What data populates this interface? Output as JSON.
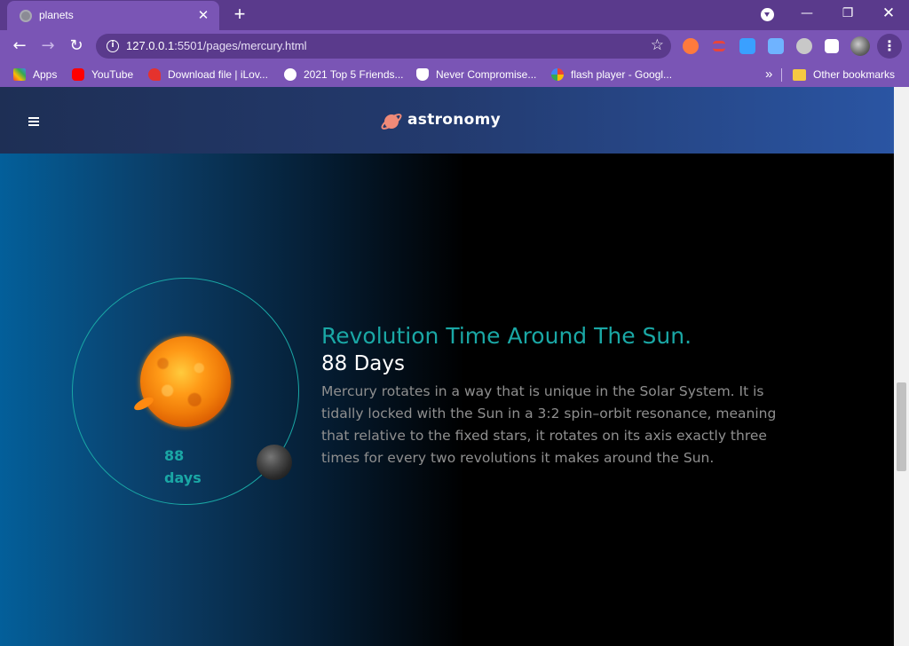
{
  "browser": {
    "tab_title": "planets",
    "tab_close": "✕",
    "new_tab": "+",
    "window_controls": {
      "minimize": "—",
      "restore": "❐",
      "close": "✕"
    },
    "nav": {
      "back": "←",
      "forward": "→",
      "reload": "↻"
    },
    "url_host": "127.0.0.1",
    "url_rest": ":5501/pages/mercury.html",
    "star": "☆",
    "menu": "⋮",
    "extensions": [
      {
        "name": "extension-infinity-icon",
        "color": "#ff7a3d"
      },
      {
        "name": "extension-stack-icon",
        "color": "#e8453c"
      },
      {
        "name": "extension-cloud-icon",
        "color": "#3aa0ff"
      },
      {
        "name": "extension-screen-icon",
        "color": "#6fb3ff"
      },
      {
        "name": "extension-globe-icon",
        "color": "#c8c8c8"
      },
      {
        "name": "extensions-puzzle-icon",
        "color": "#ffffff"
      }
    ]
  },
  "bookmarks": {
    "items": [
      {
        "label": "Apps",
        "icon": "apps-grid-icon",
        "color": "#ea4335"
      },
      {
        "label": "YouTube",
        "icon": "youtube-icon",
        "color": "#ff0000"
      },
      {
        "label": "Download file | iLov...",
        "icon": "heart-icon",
        "color": "#e5322d"
      },
      {
        "label": "2021 Top 5 Friends...",
        "icon": "globe-icon",
        "color": "#ffffff"
      },
      {
        "label": "Never Compromise...",
        "icon": "shield-icon",
        "color": "#ffffff"
      },
      {
        "label": "flash player - Googl...",
        "icon": "google-icon",
        "color": "#4285f4"
      }
    ],
    "more": "»",
    "other": {
      "label": "Other bookmarks",
      "icon": "folder-icon",
      "color": "#f5c842"
    }
  },
  "site": {
    "logo_text": "astronomy",
    "orbit_label_value": "88",
    "orbit_label_unit": "days",
    "heading": "Revolution Time Around The Sun.",
    "days": "88 Days",
    "description": "Mercury rotates in a way that is unique in the Solar System. It is tidally locked with the Sun in a 3:2 spin–orbit resonance, meaning that relative to the fixed stars, it rotates on its axis exactly three times for every two revolutions it makes around the Sun.",
    "colors": {
      "accent": "#1aa7a5",
      "header_start": "#1e2f55",
      "header_end": "#2a55a3"
    }
  }
}
